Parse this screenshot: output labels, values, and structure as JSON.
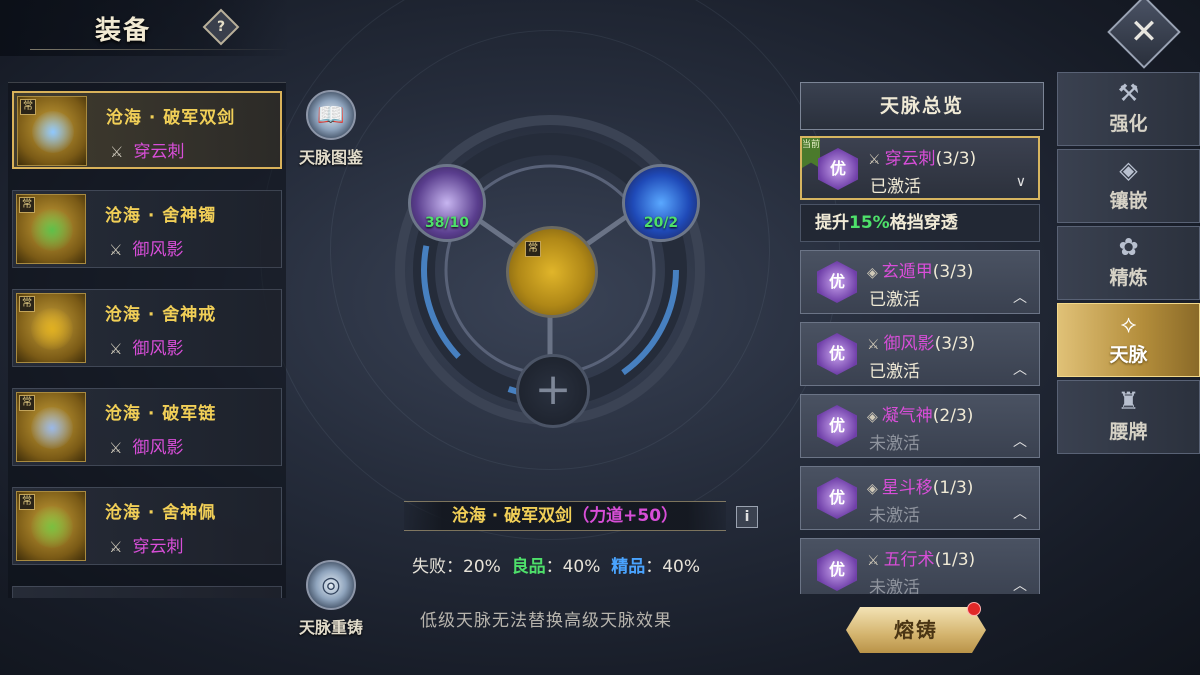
{
  "header": {
    "title": "装备",
    "help_label": "?",
    "close_label": "✕"
  },
  "equipment_list": [
    {
      "name": "沧海 · 破军双剑",
      "set": "穿云刺",
      "set_color": "#d84ed8",
      "art_color": "#8fc8ff",
      "selected": true
    },
    {
      "name": "沧海 · 舍神镯",
      "set": "御风影",
      "set_color": "#d84ed8",
      "art_color": "#5ec04a",
      "selected": false
    },
    {
      "name": "沧海 · 舍神戒",
      "set": "御风影",
      "set_color": "#d84ed8",
      "art_color": "#e0b020",
      "selected": false
    },
    {
      "name": "沧海 · 破军链",
      "set": "御风影",
      "set_color": "#d84ed8",
      "art_color": "#9ab8e8",
      "selected": false
    },
    {
      "name": "沧海 · 舍神佩",
      "set": "穿云刺",
      "set_color": "#d84ed8",
      "art_color": "#7ac040",
      "selected": false
    }
  ],
  "side_buttons": {
    "atlas_label": "天脉图鉴",
    "recast_label": "天脉重铸"
  },
  "wheel": {
    "left_slot_count": "38/10",
    "right_slot_count": "20/2",
    "add_symbol": "+",
    "equip_badge": "常"
  },
  "item_info": {
    "name": "沧海 · 破军双剑",
    "bonus_open": "（",
    "bonus": "力道+50",
    "bonus_close": "）",
    "info_label": "i"
  },
  "rates": {
    "fail_label": "失败：",
    "fail_value": "20%",
    "good_label": "良品",
    "good_value": "：40%",
    "fine_label": "精品",
    "fine_value": "：40%"
  },
  "note": "低级天脉无法替换高级天脉效果",
  "overview": {
    "title": "天脉总览",
    "current_tag": "当前",
    "description": {
      "prefix": "提升",
      "percent": "15%",
      "suffix": "格挡穿透"
    },
    "sets": [
      {
        "grade": "优",
        "icon": "⚔",
        "name": "穿云刺",
        "progress": "(3/3)",
        "status": "已激活",
        "active": true,
        "expanded": true,
        "chevron": "∨"
      },
      {
        "grade": "优",
        "icon": "◈",
        "name": "玄遁甲",
        "progress": "(3/3)",
        "status": "已激活",
        "active": false,
        "chevron": "︿"
      },
      {
        "grade": "优",
        "icon": "⚔",
        "name": "御风影",
        "progress": "(3/3)",
        "status": "已激活",
        "active": false,
        "chevron": "︿"
      },
      {
        "grade": "优",
        "icon": "◈",
        "name": "凝气神",
        "progress": "(2/3)",
        "status": "未激活",
        "active": false,
        "chevron": "︿"
      },
      {
        "grade": "优",
        "icon": "◈",
        "name": "星斗移",
        "progress": "(1/3)",
        "status": "未激活",
        "active": false,
        "chevron": "︿"
      },
      {
        "grade": "优",
        "icon": "⚔",
        "name": "五行术",
        "progress": "(1/3)",
        "status": "未激活",
        "active": false,
        "chevron": "︿"
      }
    ]
  },
  "tabs": [
    {
      "label": "强化",
      "icon": "anvil-icon",
      "glyph": "⚒",
      "active": false
    },
    {
      "label": "镶嵌",
      "icon": "gem-socket-icon",
      "glyph": "◈",
      "active": false
    },
    {
      "label": "精炼",
      "icon": "refine-icon",
      "glyph": "✿",
      "active": false
    },
    {
      "label": "天脉",
      "icon": "meridian-icon",
      "glyph": "⟡",
      "active": true
    },
    {
      "label": "腰牌",
      "icon": "token-icon",
      "glyph": "♜",
      "active": false
    }
  ],
  "forge": {
    "label": "熔铸"
  }
}
